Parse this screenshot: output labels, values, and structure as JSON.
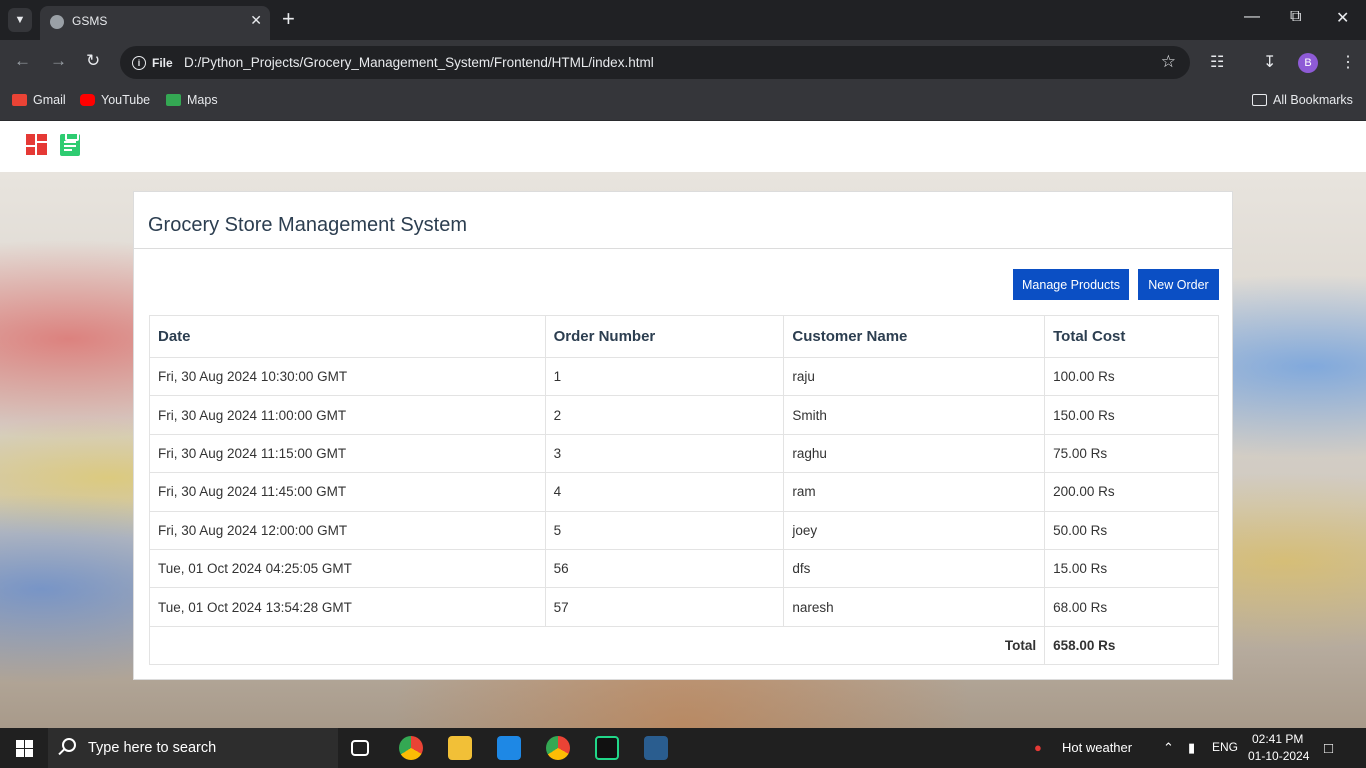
{
  "browser": {
    "tab_title": "GSMS",
    "file_chip": "File",
    "url": "D:/Python_Projects/Grocery_Management_System/Frontend/HTML/index.html",
    "profile_initial": "B",
    "bookmarks": [
      {
        "label": "Gmail",
        "icon": "gmail-icon",
        "color": "#ea4335"
      },
      {
        "label": "YouTube",
        "icon": "youtube-icon",
        "color": "#ff0000"
      },
      {
        "label": "Maps",
        "icon": "maps-icon",
        "color": "#34a853"
      }
    ],
    "all_bookmarks": "All Bookmarks"
  },
  "page": {
    "title": "Grocery Store Management System",
    "buttons": {
      "manage_products": "Manage Products",
      "new_order": "New Order"
    },
    "table": {
      "headers": [
        "Date",
        "Order Number",
        "Customer Name",
        "Total Cost"
      ],
      "rows": [
        [
          "Fri, 30 Aug 2024 10:30:00 GMT",
          "1",
          "raju",
          "100.00 Rs"
        ],
        [
          "Fri, 30 Aug 2024 11:00:00 GMT",
          "2",
          "Smith",
          "150.00 Rs"
        ],
        [
          "Fri, 30 Aug 2024 11:15:00 GMT",
          "3",
          "raghu",
          "75.00 Rs"
        ],
        [
          "Fri, 30 Aug 2024 11:45:00 GMT",
          "4",
          "ram",
          "200.00 Rs"
        ],
        [
          "Fri, 30 Aug 2024 12:00:00 GMT",
          "5",
          "joey",
          "50.00 Rs"
        ],
        [
          "Tue, 01 Oct 2024 04:25:05 GMT",
          "56",
          "dfs",
          "15.00 Rs"
        ],
        [
          "Tue, 01 Oct 2024 13:54:28 GMT",
          "57",
          "naresh",
          "68.00 Rs"
        ]
      ],
      "total_label": "Total",
      "total_value": "658.00 Rs"
    },
    "colors": {
      "primary_button": "#0b4fc4",
      "dashboard_icon": "#e53935",
      "orders_icon": "#2ecc71"
    }
  },
  "taskbar": {
    "search_placeholder": "Type here to search",
    "weather": "Hot weather",
    "language": "ENG",
    "time": "02:41 PM",
    "date": "01-10-2024"
  }
}
